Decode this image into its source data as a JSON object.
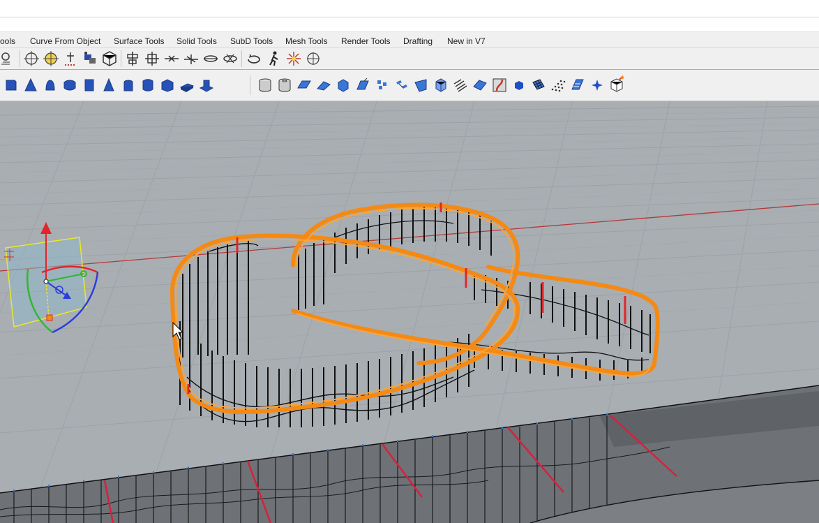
{
  "tabs": {
    "t0": "ools",
    "t1": "Curve From Object",
    "t2": "Surface Tools",
    "t3": "Solid Tools",
    "t4": "SubD Tools",
    "t5": "Mesh Tools",
    "t6": "Render Tools",
    "t7": "Drafting",
    "t8": "New in V7"
  },
  "toolbar_row1_icons": [
    "zoom-icon",
    "snap-target-icon",
    "snap-center-icon",
    "gumball-align-icon",
    "named-view-icon",
    "view-cube-icon",
    "align-icon",
    "distribute-icon",
    "split-icon",
    "orient-icon",
    "mirror-icon",
    "array-icon",
    "rotate-view-icon",
    "walk-icon",
    "light-icon",
    "target-icon"
  ],
  "toolbar_row2_icons": [
    "solid-box-icon",
    "solid-cone-icon",
    "solid-sphere-icon",
    "solid-torus-icon",
    "solid-cylinder-icon",
    "solid-pyramid-icon",
    "solid-ellipsoid-icon",
    "solid-pipe-icon",
    "solid-wedge-icon",
    "solid-extrude-icon",
    "solid-slab-icon",
    "subd-cylinder-icon",
    "subd-tube-icon",
    "subd-plane-icon",
    "subd-face-icon",
    "subd-cube-icon",
    "subd-loft-icon",
    "subd-grid-icon",
    "subd-bridge-icon",
    "subd-sweep-icon",
    "subd-box-icon",
    "subd-stripes-icon",
    "subd-flip-icon",
    "subd-crease-icon",
    "subd-point-icon",
    "subd-mesh-icon",
    "subd-pointcloud-icon",
    "subd-ribbon-icon",
    "subd-star-icon",
    "subd-convert-icon"
  ],
  "colors": {
    "viewport_bg": "#a9aeb3",
    "grid_line": "#9ca1a6",
    "x_axis": "#b23a3a",
    "selection": "#f48a14",
    "gumball_x": "#e0262c",
    "gumball_y": "#2fb82f",
    "gumball_z": "#2a3fd8",
    "plane_outline": "#e8e82a"
  }
}
